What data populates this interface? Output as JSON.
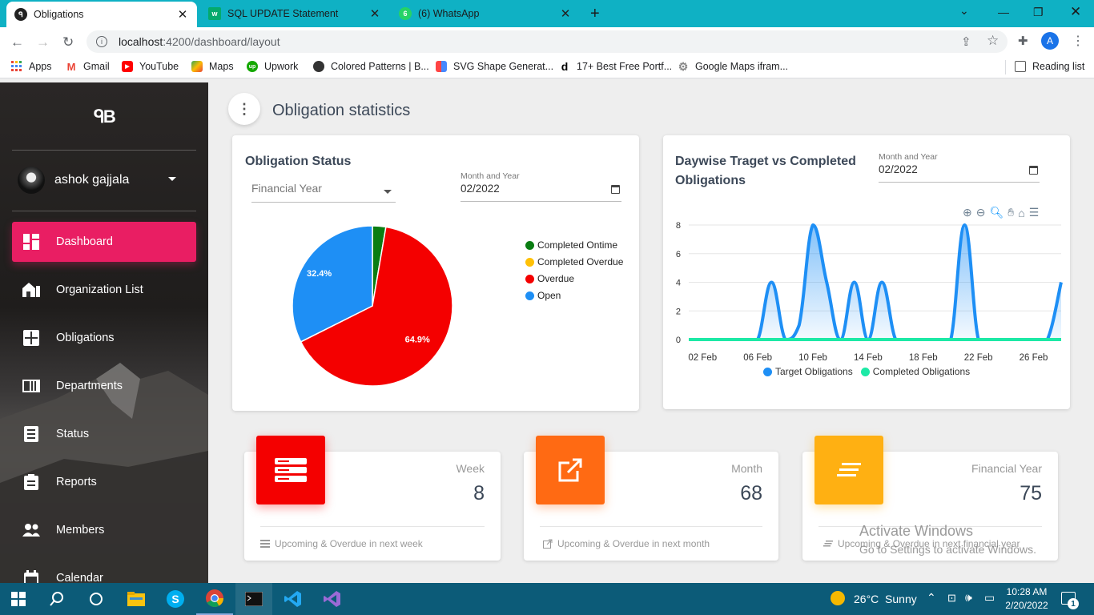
{
  "browser": {
    "tabs": [
      {
        "title": "Obligations",
        "icon": "app-logo-icon",
        "active": true
      },
      {
        "title": "SQL UPDATE Statement",
        "icon": "w3schools-icon",
        "active": false
      },
      {
        "title": "(6) WhatsApp",
        "icon": "whatsapp-icon",
        "active": false
      }
    ],
    "url_host": "localhost",
    "url_path": ":4200/dashboard/layout",
    "avatar_letter": "A",
    "bookmarks": [
      {
        "label": "Apps",
        "icon": "apps-grid-icon"
      },
      {
        "label": "Gmail",
        "icon": "gmail-icon"
      },
      {
        "label": "YouTube",
        "icon": "youtube-icon"
      },
      {
        "label": "Maps",
        "icon": "maps-icon"
      },
      {
        "label": "Upwork",
        "icon": "upwork-icon"
      },
      {
        "label": "Colored Patterns | B...",
        "icon": "globe-icon"
      },
      {
        "label": "SVG Shape Generat...",
        "icon": "svg-generator-icon"
      },
      {
        "label": "17+ Best Free Portf...",
        "icon": "dev-icon"
      },
      {
        "label": "Google Maps ifram...",
        "icon": "gear-icon"
      }
    ],
    "reading_list": "Reading list"
  },
  "sidebar": {
    "logo": "ᑫB",
    "user_name": "ashok gajjala",
    "items": [
      {
        "label": "Dashboard",
        "icon": "dashboard-icon",
        "active": true
      },
      {
        "label": "Organization List",
        "icon": "organization-icon",
        "active": false
      },
      {
        "label": "Obligations",
        "icon": "obligations-icon",
        "active": false
      },
      {
        "label": "Departments",
        "icon": "departments-icon",
        "active": false
      },
      {
        "label": "Status",
        "icon": "status-icon",
        "active": false
      },
      {
        "label": "Reports",
        "icon": "reports-icon",
        "active": false
      },
      {
        "label": "Members",
        "icon": "members-icon",
        "active": false
      },
      {
        "label": "Calendar",
        "icon": "calendar-icon",
        "active": false
      }
    ]
  },
  "page": {
    "title": "Obligation statistics"
  },
  "status_card": {
    "title": "Obligation Status",
    "select_placeholder": "Financial Year",
    "date_label": "Month and Year",
    "date_value": "02/2022"
  },
  "daywise_card": {
    "title_line1": "Daywise Traget vs Completed",
    "title_line2": "Obligations",
    "date_label": "Month and Year",
    "date_value": "02/2022"
  },
  "chart_data": [
    {
      "type": "pie",
      "title": "Obligation Status",
      "categories": [
        "Completed Ontime",
        "Completed Overdue",
        "Overdue",
        "Open"
      ],
      "values": [
        2.7,
        0,
        64.9,
        32.4
      ],
      "data_labels": [
        "",
        "",
        "64.9%",
        "32.4%"
      ],
      "colors": [
        "#0a7d12",
        "#ffc107",
        "#f40000",
        "#1e8ff5"
      ],
      "legend_position": "right"
    },
    {
      "type": "area",
      "title": "Daywise Traget vs Completed Obligations",
      "x_ticks": [
        "02 Feb",
        "06 Feb",
        "10 Feb",
        "14 Feb",
        "18 Feb",
        "22 Feb",
        "26 Feb"
      ],
      "y_ticks": [
        "0",
        "2",
        "4",
        "6",
        "8"
      ],
      "ylim": [
        0,
        8
      ],
      "xlim": [
        1,
        28
      ],
      "series": [
        {
          "name": "Target Obligations",
          "color": "#1e8ff5",
          "x": [
            1,
            2,
            3,
            4,
            5,
            6,
            7,
            8,
            9,
            10,
            11,
            12,
            13,
            14,
            15,
            16,
            17,
            18,
            19,
            20,
            21,
            22,
            23,
            24,
            25,
            26,
            27,
            28
          ],
          "values": [
            0,
            0,
            0,
            0,
            0,
            0,
            4,
            0,
            1,
            8,
            4,
            0,
            4,
            0,
            4,
            0,
            0,
            0,
            0,
            0,
            8,
            0,
            0,
            0,
            0,
            0,
            0,
            4
          ]
        },
        {
          "name": "Completed Obligations",
          "color": "#1de9a6",
          "x": [
            1,
            2,
            3,
            4,
            5,
            6,
            7,
            8,
            9,
            10,
            11,
            12,
            13,
            14,
            15,
            16,
            17,
            18,
            19,
            20,
            21,
            22,
            23,
            24,
            25,
            26,
            27,
            28
          ],
          "values": [
            0,
            0,
            0,
            0,
            0,
            0,
            0,
            0,
            0,
            0,
            0,
            0,
            0,
            0,
            0,
            0,
            0,
            0,
            0,
            0,
            0,
            0,
            0,
            0,
            0,
            0,
            0,
            0
          ]
        }
      ],
      "legend_position": "bottom",
      "grid": true
    }
  ],
  "stats": [
    {
      "category": "Week",
      "value": "8",
      "footer": "Upcoming & Overdue in next week",
      "color": "#f40000",
      "icon": "server-icon"
    },
    {
      "category": "Month",
      "value": "68",
      "footer": "Upcoming & Overdue in next month",
      "color": "#ff6a13",
      "icon": "open-external-icon"
    },
    {
      "category": "Financial Year",
      "value": "75",
      "footer": "Upcoming & Overdue in next financial year",
      "color": "#ffb012",
      "icon": "lines-icon"
    }
  ],
  "watermark": {
    "line1": "Activate Windows",
    "line2": "Go to Settings to activate Windows."
  },
  "taskbar": {
    "weather": "26°C  Sunny",
    "time": "10:28 AM",
    "date": "2/20/2022",
    "notifications": "1"
  }
}
